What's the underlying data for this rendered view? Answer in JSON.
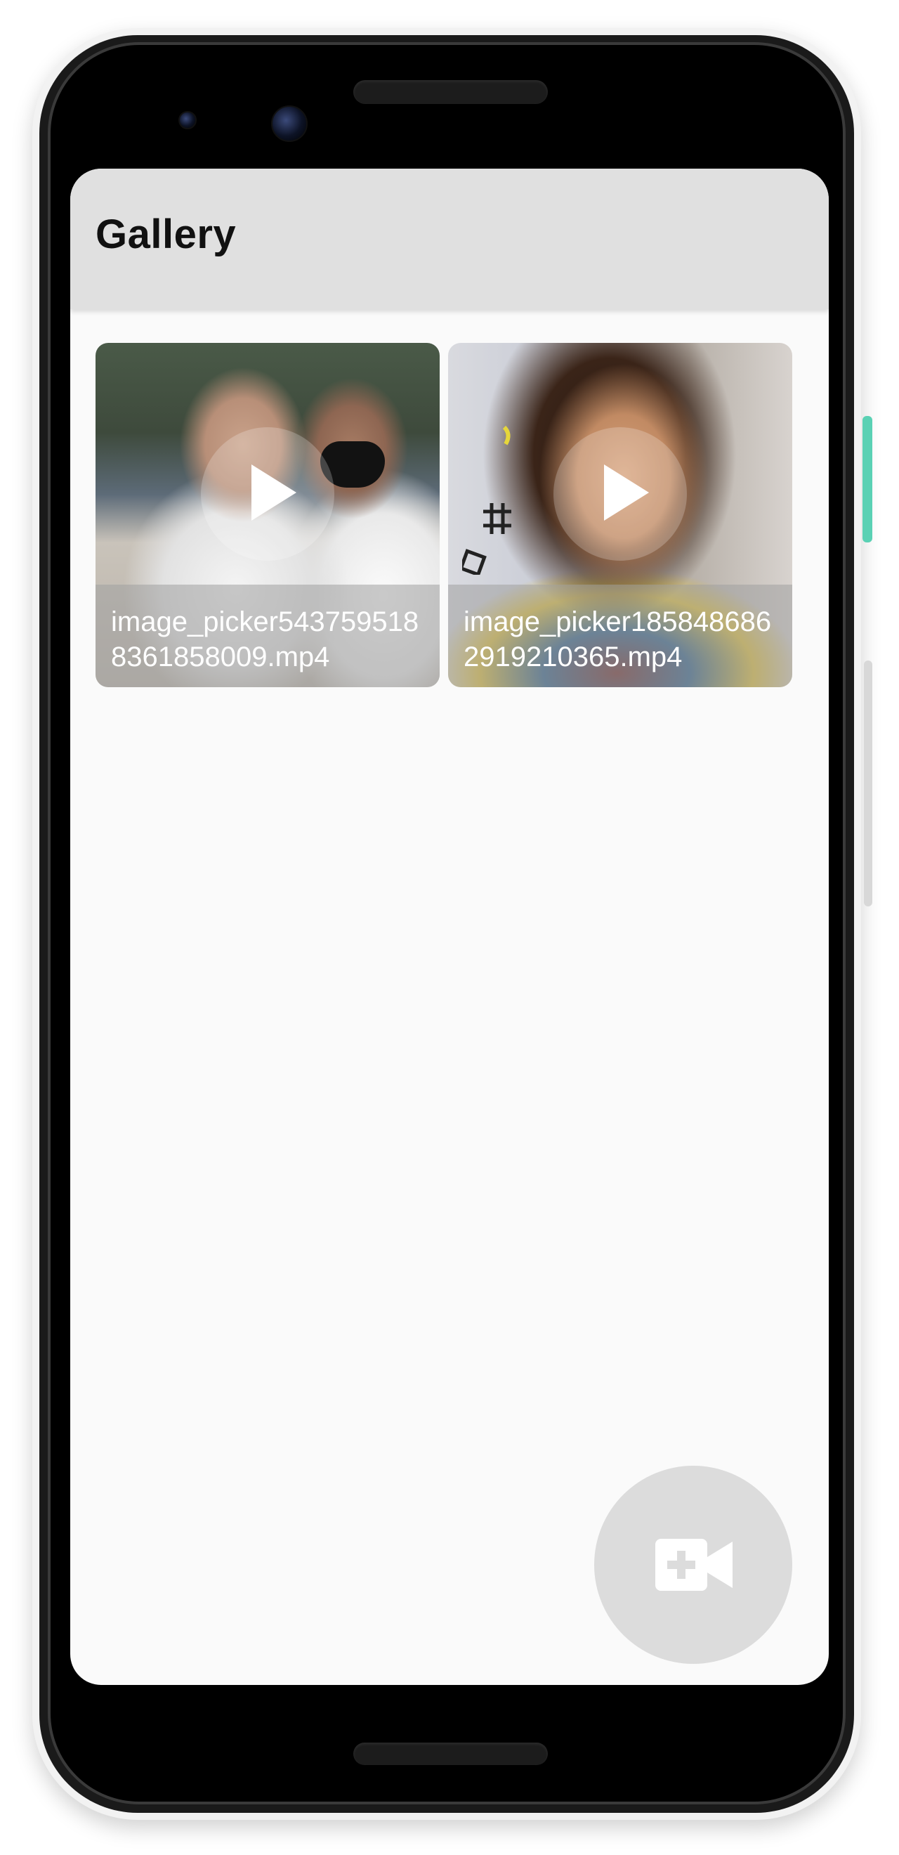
{
  "app_bar": {
    "title": "Gallery"
  },
  "gallery": {
    "items": [
      {
        "file_name": "image_picker5437595188361858009.mp4",
        "icon": "play-icon"
      },
      {
        "file_name": "image_picker1858486862919210365.mp4",
        "icon": "play-icon"
      }
    ]
  },
  "fab": {
    "icon": "video-add-icon"
  },
  "colors": {
    "app_bar_bg": "#e0e0e0",
    "screen_bg": "#fafafa",
    "fab_bg": "#dcdcdc",
    "caption_text": "#ffffff"
  }
}
